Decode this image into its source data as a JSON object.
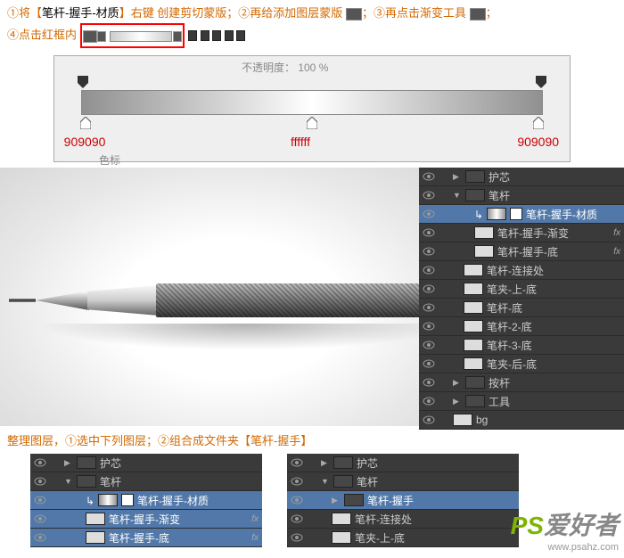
{
  "instructions": {
    "line1_a": "①将【",
    "line1_b": "笔杆-握手-材质",
    "line1_c": "】右键 创建剪切蒙版；②再给添加图层蒙版",
    "line1_d": "；③再点击渐变工具",
    "line1_e": "；",
    "line2_a": "④点击红框内"
  },
  "gradient_editor": {
    "opacity_text": "不透明度： 100   %",
    "stops_label": "色标",
    "stops": [
      {
        "color": "909090",
        "pos": 6
      },
      {
        "color": "ffffff",
        "pos": 50
      },
      {
        "color": "909090",
        "pos": 94
      }
    ]
  },
  "layers_main": [
    {
      "type": "folder",
      "name": "护芯",
      "indent": 1
    },
    {
      "type": "folder",
      "name": "笔杆",
      "indent": 1,
      "open": true
    },
    {
      "type": "layer",
      "name": "笔杆-握手-材质",
      "indent": 3,
      "sel": true,
      "thumb": "g",
      "link": true,
      "mask": true
    },
    {
      "type": "layer",
      "name": "笔杆-握手-渐变",
      "indent": 3,
      "thumb": "w",
      "fx": true
    },
    {
      "type": "layer",
      "name": "笔杆-握手-底",
      "indent": 3,
      "thumb": "w",
      "fx": "f"
    },
    {
      "type": "layer",
      "name": "笔杆-连接处",
      "indent": 2,
      "thumb": "w"
    },
    {
      "type": "layer",
      "name": "笔夹-上-底",
      "indent": 2,
      "thumb": "w"
    },
    {
      "type": "layer",
      "name": "笔杆-底",
      "indent": 2,
      "thumb": "w"
    },
    {
      "type": "layer",
      "name": "笔杆-2-底",
      "indent": 2,
      "thumb": "w"
    },
    {
      "type": "layer",
      "name": "笔杆-3-底",
      "indent": 2,
      "thumb": "w"
    },
    {
      "type": "layer",
      "name": "笔夹-后-底",
      "indent": 2,
      "thumb": "w"
    },
    {
      "type": "folder",
      "name": "按杆",
      "indent": 1
    },
    {
      "type": "folder",
      "name": "工具",
      "indent": 1
    },
    {
      "type": "layer",
      "name": "bg",
      "indent": 1,
      "thumb": "w"
    }
  ],
  "instr2": "整理图层，①选中下列图层；②组合成文件夹【笔杆-握手】",
  "bottom_left": [
    {
      "type": "folder",
      "name": "护芯",
      "indent": 1
    },
    {
      "type": "folder",
      "name": "笔杆",
      "indent": 1,
      "open": true
    },
    {
      "type": "layer",
      "name": "笔杆-握手-材质",
      "indent": 3,
      "sel": true,
      "thumb": "g",
      "link": true,
      "mask": true
    },
    {
      "type": "layer",
      "name": "笔杆-握手-渐变",
      "indent": 3,
      "sel": true,
      "thumb": "w",
      "fx": true
    },
    {
      "type": "layer",
      "name": "笔杆-握手-底",
      "indent": 3,
      "sel": true,
      "thumb": "w",
      "fx": true
    }
  ],
  "bottom_right": [
    {
      "type": "folder",
      "name": "护芯",
      "indent": 1
    },
    {
      "type": "folder",
      "name": "笔杆",
      "indent": 1,
      "open": true
    },
    {
      "type": "folder",
      "name": "笔杆-握手",
      "indent": 2,
      "sel": true
    },
    {
      "type": "layer",
      "name": "笔杆-连接处",
      "indent": 2,
      "thumb": "w"
    },
    {
      "type": "layer",
      "name": "笔夹-上-底",
      "indent": 2,
      "thumb": "w"
    }
  ],
  "watermark": {
    "brand_ps": "PS",
    "brand_txt": "爱好者",
    "url": "www.psahz.com"
  }
}
